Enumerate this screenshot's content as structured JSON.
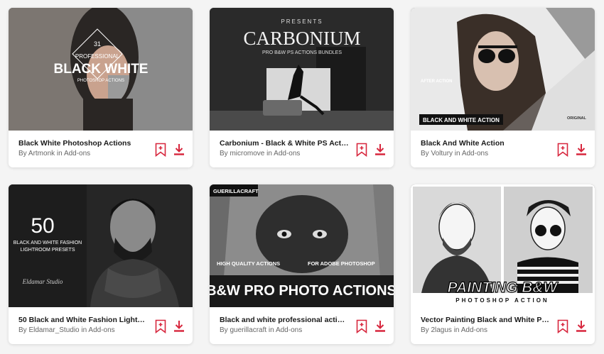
{
  "accent": "#d7263d",
  "cards": [
    {
      "title": "Black White Photoshop Actions",
      "author": "Artmonk",
      "category": "Add-ons",
      "thumb": {
        "line1": "31",
        "line2": "PROFESSIONAL",
        "line3": "BLACK WHITE",
        "line4": "PHOTOSHOP ACTIONS"
      }
    },
    {
      "title": "Carbonium - Black & White PS Act…",
      "author": "micromove",
      "category": "Add-ons",
      "thumb": {
        "line1": "PRESENTS",
        "line2": "CARBONIUM",
        "line3": "PRO B&W PS ACTIONS BUNDLES"
      }
    },
    {
      "title": "Black And White Action",
      "author": "Voltury",
      "category": "Add-ons",
      "thumb": {
        "line1": "AFTER ACTION",
        "line2": "BLACK AND WHITE ACTION",
        "line3": "ORIGINAL"
      }
    },
    {
      "title": "50 Black and White Fashion Light…",
      "author": "Eldamar_Studio",
      "category": "Add-ons",
      "thumb": {
        "line1": "50",
        "line2": "BLACK AND WHITE FASHION",
        "line3": "LIGHTROOM PRESETS",
        "line4": "Eldamar Studio"
      }
    },
    {
      "title": "Black and white professional acti…",
      "author": "guerillacraft",
      "category": "Add-ons",
      "thumb": {
        "line1": "GUERILLACRAFT",
        "line2": "HIGH QUALITY ACTIONS",
        "line3": "FOR ADOBE PHOTOSHOP",
        "line4": "B&W PRO PHOTO ACTIONS"
      }
    },
    {
      "title": "Vector Painting Black and White P…",
      "author": "2lagus",
      "category": "Add-ons",
      "thumb": {
        "line1": "PAINTING B&W",
        "line2": "PHOTOSHOP ACTION"
      }
    }
  ]
}
